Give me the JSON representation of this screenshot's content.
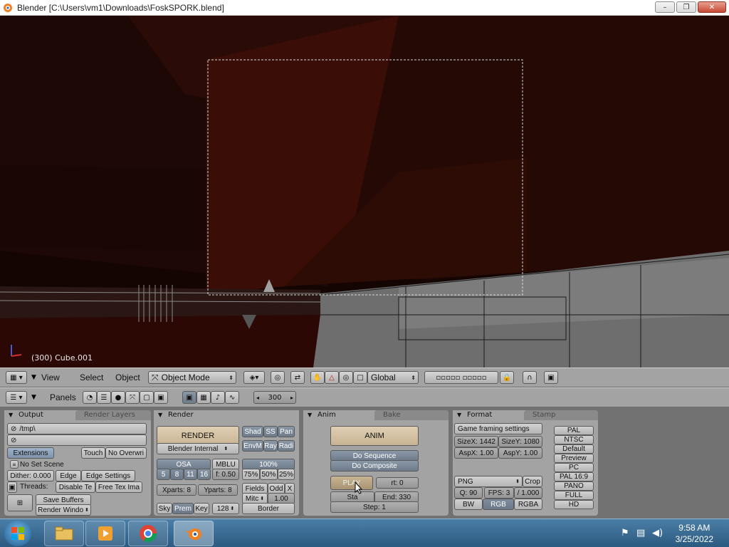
{
  "window": {
    "title": "Blender [C:\\Users\\vm1\\Downloads\\FoskSPORK.blend]",
    "min": "–",
    "max": "❐",
    "close": "✕"
  },
  "viewport": {
    "info": "(300) Cube.001"
  },
  "header3d": {
    "view": "View",
    "select": "Select",
    "object": "Object",
    "mode": "Object Mode",
    "orientation": "Global"
  },
  "buttons_header": {
    "panels": "Panels",
    "frame": "300"
  },
  "output": {
    "tab_output": "Output",
    "tab_render_layers": "Render Layers",
    "path": "/tmp\\",
    "extensions": "Extensions",
    "touch": "Touch",
    "no_overwrite": "No Overwri",
    "no_set_scene": "No Set Scene",
    "dither": "Dither: 0.000",
    "edge": "Edge",
    "edge_settings": "Edge Settings",
    "threads": "Threads:",
    "disable_tex": "Disable Te",
    "free_tex": "Free Tex Ima",
    "save_buffers": "Save Buffers",
    "render_window": "Render Windo"
  },
  "render": {
    "tab": "Render",
    "render_btn": "RENDER",
    "engine": "Blender Internal",
    "shad": "Shad",
    "ss": "SS",
    "pan": "Pan",
    "envm": "EnvM",
    "ray": "Ray",
    "radi": "Radi",
    "osa": "OSA",
    "osa_vals": [
      "5",
      "8",
      "11",
      "16"
    ],
    "mblu": "MBLU",
    "mblu_f": "f: 0.50",
    "pct": "100%",
    "pct_vals": [
      "75%",
      "50%",
      "25%"
    ],
    "xparts": "Xparts: 8",
    "yparts": "Yparts: 8",
    "fields": "Fields",
    "odd": "Odd",
    "x": "X",
    "mitc": "Mitc",
    "mitc_val": "1.00",
    "sky": "Sky",
    "prem": "Prem",
    "key": "Key",
    "depth": "128",
    "border": "Border"
  },
  "anim": {
    "tab_anim": "Anim",
    "tab_bake": "Bake",
    "anim_btn": "ANIM",
    "do_sequence": "Do Sequence",
    "do_composite": "Do Composite",
    "play": "PLAY",
    "rt": "rt: 0",
    "sta": "Sta",
    "end": "End: 330",
    "step": "Step: 1"
  },
  "format": {
    "tab_format": "Format",
    "tab_stamp": "Stamp",
    "game_framing": "Game framing settings",
    "sizex": "SizeX: 1442",
    "sizey": "SizeY: 1080",
    "aspx": "AspX: 1.00",
    "aspy": "AspY: 1.00",
    "filetype": "PNG",
    "crop": "Crop",
    "q": "Q: 90",
    "fps": "FPS: 3",
    "fps_div": "/ 1.000",
    "bw": "BW",
    "rgb": "RGB",
    "rgba": "RGBA",
    "presets": [
      "PAL",
      "NTSC",
      "Default",
      "Preview",
      "PC",
      "PAL 16:9",
      "PANO",
      "FULL",
      "HD"
    ]
  },
  "taskbar": {
    "time": "9:58 AM",
    "date": "3/25/2022"
  },
  "colors": {
    "panel": "#a3a3a3",
    "viewport_bg": "#1a0704",
    "taskbar": "#2c5a80"
  }
}
